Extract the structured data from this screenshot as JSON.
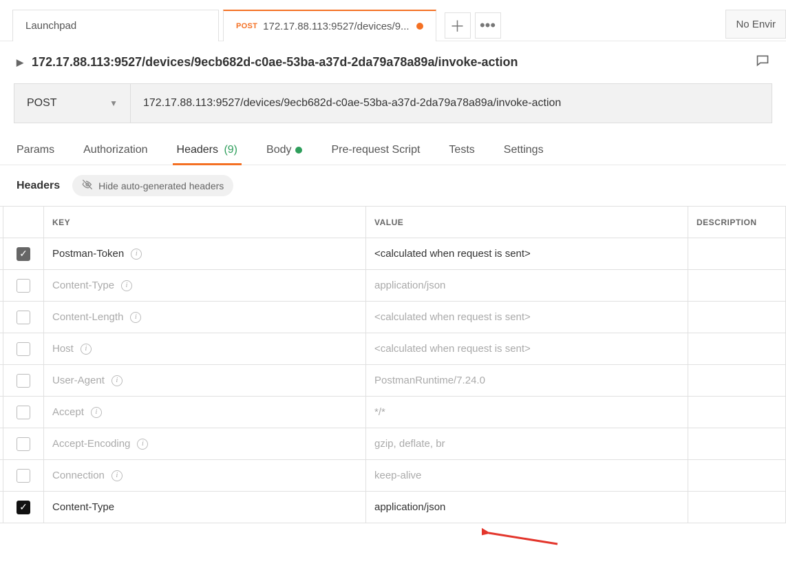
{
  "tabs": {
    "launchpad": "Launchpad",
    "active": {
      "method": "POST",
      "label": "172.17.88.113:9527/devices/9..."
    }
  },
  "env_label": "No Envir",
  "title": "172.17.88.113:9527/devices/9ecb682d-c0ae-53ba-a37d-2da79a78a89a/invoke-action",
  "request": {
    "method": "POST",
    "url": "172.17.88.113:9527/devices/9ecb682d-c0ae-53ba-a37d-2da79a78a89a/invoke-action"
  },
  "req_tabs": {
    "params": "Params",
    "auth": "Authorization",
    "headers": "Headers",
    "headers_count": "(9)",
    "body": "Body",
    "prerequest": "Pre-request Script",
    "tests": "Tests",
    "settings": "Settings"
  },
  "section": {
    "headers_label": "Headers",
    "hide_label": "Hide auto-generated headers"
  },
  "table": {
    "columns": {
      "key": "KEY",
      "value": "VALUE",
      "desc": "DESCRIPTION"
    },
    "rows": [
      {
        "checked": true,
        "disabled": false,
        "key": "Postman-Token",
        "info": true,
        "value": "<calculated when request is sent>"
      },
      {
        "checked": false,
        "disabled": true,
        "key": "Content-Type",
        "info": true,
        "value": "application/json"
      },
      {
        "checked": false,
        "disabled": true,
        "key": "Content-Length",
        "info": true,
        "value": "<calculated when request is sent>"
      },
      {
        "checked": false,
        "disabled": true,
        "key": "Host",
        "info": true,
        "value": "<calculated when request is sent>"
      },
      {
        "checked": false,
        "disabled": true,
        "key": "User-Agent",
        "info": true,
        "value": "PostmanRuntime/7.24.0"
      },
      {
        "checked": false,
        "disabled": true,
        "key": "Accept",
        "info": true,
        "value": "*/*"
      },
      {
        "checked": false,
        "disabled": true,
        "key": "Accept-Encoding",
        "info": true,
        "value": "gzip, deflate, br"
      },
      {
        "checked": false,
        "disabled": true,
        "key": "Connection",
        "info": true,
        "value": "keep-alive"
      },
      {
        "checked": true,
        "checked_dark": true,
        "disabled": false,
        "key": "Content-Type",
        "info": false,
        "value": "application/json"
      }
    ]
  }
}
